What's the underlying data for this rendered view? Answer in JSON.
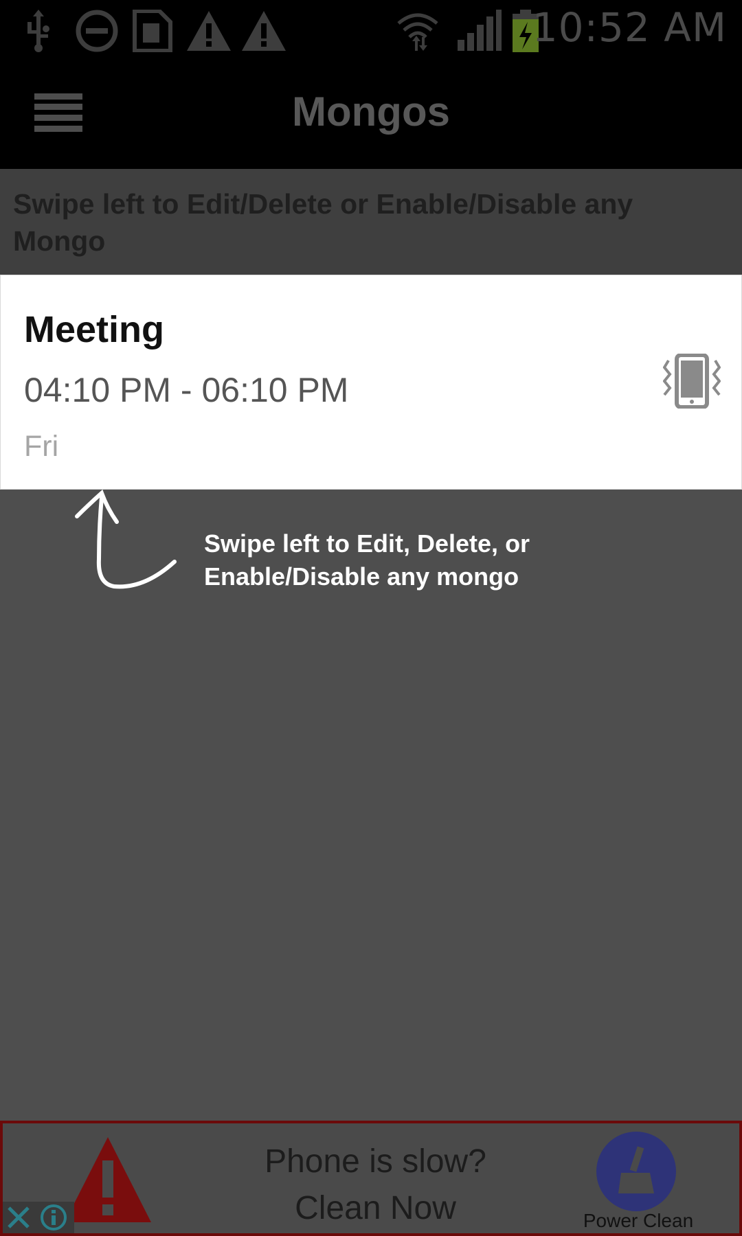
{
  "status_bar": {
    "time": "10:52 AM",
    "icons": [
      "usb-icon",
      "do-not-disturb-icon",
      "sim-card-icon",
      "warning-icon",
      "warning-icon",
      "wifi-icon",
      "signal-icon",
      "battery-charging-icon"
    ]
  },
  "app_bar": {
    "title": "Mongos",
    "menu_icon": "hamburger-menu-icon"
  },
  "hint": {
    "text": "Swipe left to Edit/Delete or Enable/Disable any Mongo"
  },
  "mongo_list": [
    {
      "title": "Meeting",
      "time_range": "04:10 PM - 06:10 PM",
      "days": "Fri",
      "mode_icon": "vibrate-phone-icon"
    }
  ],
  "annotation": {
    "text": "Swipe left to Edit, Delete, or Enable/Disable any mongo"
  },
  "ad": {
    "line1": "Phone is slow?",
    "line2": "Clean Now",
    "button_label": "Power Clean",
    "colors": {
      "border": "#6b0a0a",
      "button": "#2e3378",
      "warning": "#7a0d0d"
    }
  }
}
